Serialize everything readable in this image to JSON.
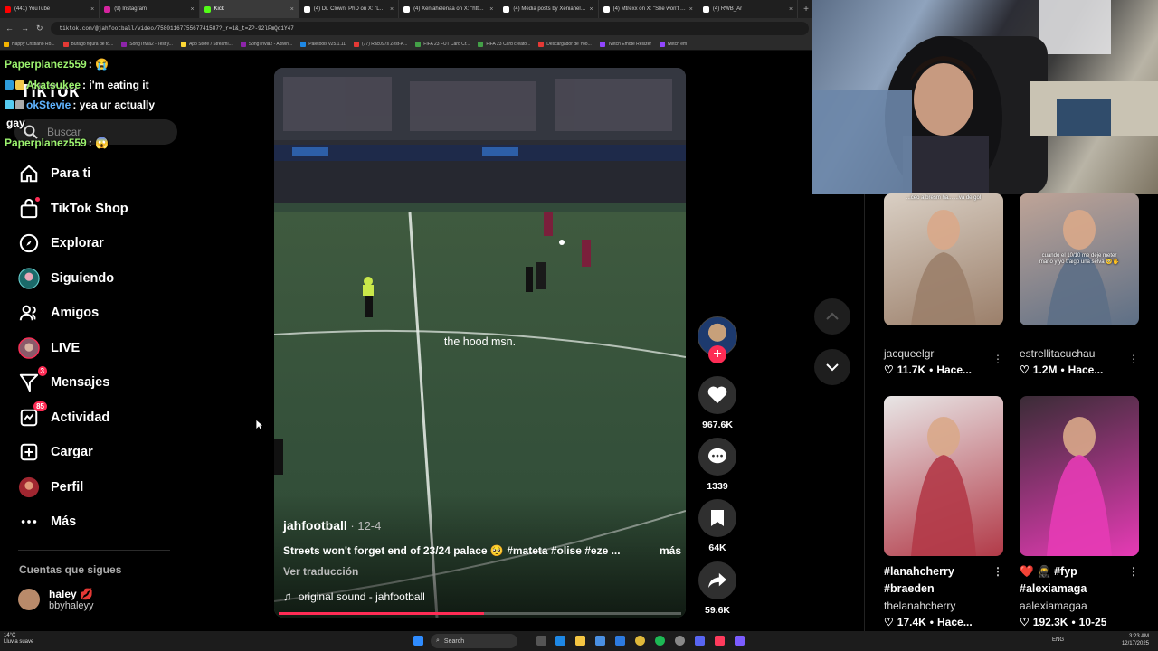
{
  "browser": {
    "tabs": [
      {
        "title": "(441) YouTube",
        "color": "#ff0000",
        "active": false
      },
      {
        "title": "(9) Instagram",
        "color": "#d6249f",
        "active": false
      },
      {
        "title": "Kick",
        "color": "#53fc18",
        "active": true
      },
      {
        "title": "(4) Dr. Clown, PhD on X: \"Let's",
        "color": "#ffffff",
        "active": false
      },
      {
        "title": "(4) Xeniahelenaa on X: \"https:/",
        "color": "#ffffff",
        "active": false
      },
      {
        "title": "(4) Media posts by Xeniahelena",
        "color": "#ffffff",
        "active": false
      },
      {
        "title": "(4) Mtrexx on X: \"She won't eve",
        "color": "#ffffff",
        "active": false
      },
      {
        "title": "(4) RWB_Ar",
        "color": "#ffffff",
        "active": false
      }
    ],
    "url": "tiktok.com/@jahfootball/video/7580116775567741587?_r=1&_t=ZP-92lFmQc1Y47",
    "bookmarks": [
      {
        "label": "Happy Cristiano Ro...",
        "color": "#f4b400"
      },
      {
        "label": "Burago figura de to...",
        "color": "#e53935"
      },
      {
        "label": "SongTrivia2 - Test y...",
        "color": "#8e24aa"
      },
      {
        "label": "App Store / Streami...",
        "color": "#fdd835"
      },
      {
        "label": "SongTrivia2 - Adivin...",
        "color": "#8e24aa"
      },
      {
        "label": "Paletools v25.1.11",
        "color": "#1e88e5"
      },
      {
        "label": "(77) Rac097s Zest-A...",
        "color": "#e53935"
      },
      {
        "label": "FIFA 23 FUT Card Cr...",
        "color": "#43a047"
      },
      {
        "label": "FIFA 23 Card creato...",
        "color": "#43a047"
      },
      {
        "label": "Descargador de Yoo...",
        "color": "#e53935"
      },
      {
        "label": "Twitch Emote Resizer",
        "color": "#9146ff"
      },
      {
        "label": "twitch em",
        "color": "#9146ff"
      }
    ]
  },
  "chat": [
    {
      "user": "Paperplanez559",
      "text": ": 😭",
      "userColor": "#9cf26e"
    },
    {
      "user": "Akatsukee",
      "text": ": i'm eating it",
      "userColor": "#9cf26e"
    },
    {
      "user": "okStevie",
      "text": ": yea ur actually",
      "userColor": "#60b4ff"
    },
    {
      "user": "",
      "text": "gay",
      "userColor": "#ffffff"
    },
    {
      "user": "Paperplanez559",
      "text": ": 😱",
      "userColor": "#9cf26e"
    }
  ],
  "tiktok": {
    "logo": "TikTok",
    "search_placeholder": "Buscar",
    "nav": [
      {
        "label": "Para ti",
        "icon": "home-icon"
      },
      {
        "label": "TikTok Shop",
        "icon": "shop-icon"
      },
      {
        "label": "Explorar",
        "icon": "compass-icon"
      },
      {
        "label": "Siguiendo",
        "icon": "following-icon"
      },
      {
        "label": "Amigos",
        "icon": "friends-icon"
      },
      {
        "label": "LIVE",
        "icon": "live-icon"
      },
      {
        "label": "Mensajes",
        "icon": "messages-icon",
        "badge": "3"
      },
      {
        "label": "Actividad",
        "icon": "activity-icon",
        "badge": "85"
      },
      {
        "label": "Cargar",
        "icon": "upload-icon"
      },
      {
        "label": "Perfil",
        "icon": "profile-icon"
      },
      {
        "label": "Más",
        "icon": "more-icon"
      }
    ],
    "following_heading": "Cuentas que sigues",
    "following": [
      {
        "name": "haley 💋",
        "handle": "bbyhaleyy"
      }
    ]
  },
  "video": {
    "caption": "the hood msn.",
    "author": "jahfootball",
    "date": " · 12-4",
    "description": "Streets won't forget end of 23/24 palace 🥺 #mateta #olise #eze ...",
    "more": "más",
    "translate": "Ver traducción",
    "sound": "original sound - jahfootball",
    "progress": 0.51
  },
  "actions": {
    "likes": "967.6K",
    "comments": "1339",
    "saves": "64K",
    "shares": "59.6K"
  },
  "grid": [
    {
      "user": "jacqueelgr",
      "likes": "11.7K",
      "time": "Hace...",
      "title": "",
      "overlay": "...ceo a bresm ha... ...va de gol",
      "colors": [
        "#d9cfc4",
        "#9b7f6a"
      ]
    },
    {
      "user": "estrellitacuchau",
      "likes": "1.2M",
      "time": "Hace...",
      "title": "",
      "overlay": "cuando el 10/10 me deje meter mano y yo traigo una selva 🥺🖐",
      "colors": [
        "#bfa497",
        "#5d6f86"
      ]
    },
    {
      "user": "thelanahcherry",
      "likes": "17.4K",
      "time": "Hace...",
      "title": "#lanahcherry #braeden",
      "overlay": "",
      "colors": [
        "#e8e6e6",
        "#b23a48"
      ]
    },
    {
      "user": "aalexiamagaa",
      "likes": "192.3K",
      "time": "10-25",
      "title": "❤️ 🥷 #fyp #alexiamaga",
      "overlay": "",
      "colors": [
        "#3a2c36",
        "#e63bb5"
      ]
    }
  ],
  "taskbar": {
    "weather_temp": "14°C",
    "weather_desc": "Lluvia suave",
    "search_label": "Search",
    "lang": "ENG",
    "time": "3:23 AM",
    "date": "12/17/2025"
  }
}
